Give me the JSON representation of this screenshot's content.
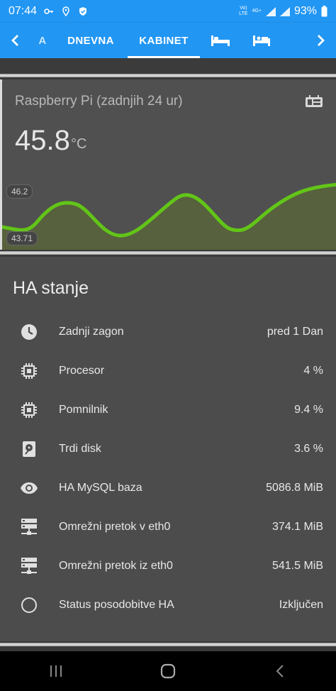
{
  "status_bar": {
    "time": "07:44",
    "volte_label": "Vo)\nLTE",
    "net_label": "4G+",
    "battery": "93%"
  },
  "app_bar": {
    "tabs": [
      {
        "label": "A"
      },
      {
        "label": "DNEVNA"
      },
      {
        "label": "KABINET"
      }
    ],
    "active_tab": "KABINET",
    "accent": "#2196f3"
  },
  "sensor_card": {
    "name": "Raspberry Pi (zadnjih 24 ur)",
    "value": "45.8",
    "unit": "°C",
    "max_label": "46.2",
    "min_label": "43.71",
    "line_color": "#62c518",
    "icon": "chip-board-icon"
  },
  "ha_card": {
    "title": "HA stanje",
    "rows": [
      {
        "icon": "clock-icon",
        "name": "Zadnji zagon",
        "value": "pred 1 Dan"
      },
      {
        "icon": "cpu-icon",
        "name": "Procesor",
        "value": "4 %"
      },
      {
        "icon": "cpu-icon",
        "name": "Pomnilnik",
        "value": "9.4 %"
      },
      {
        "icon": "harddisk-icon",
        "name": "Trdi disk",
        "value": "3.6 %"
      },
      {
        "icon": "eye-icon",
        "name": "HA MySQL baza",
        "value": "5086.8 MiB"
      },
      {
        "icon": "server-network-icon",
        "name": "Omrežni pretok v eth0",
        "value": "374.1 MiB"
      },
      {
        "icon": "server-network-icon",
        "name": "Omrežni pretok iz eth0",
        "value": "541.5 MiB"
      },
      {
        "icon": "circle-outline-icon",
        "name": "Status posodobitve HA",
        "value": "Izključen"
      }
    ]
  }
}
